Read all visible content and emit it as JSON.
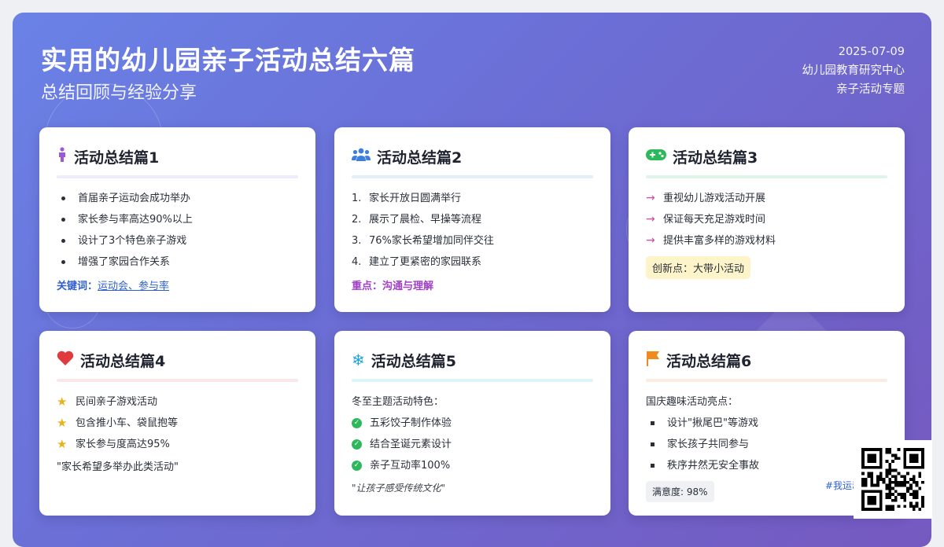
{
  "header": {
    "title": "实用的幼儿园亲子活动总结六篇",
    "subtitle": "总结回顾与经验分享",
    "date": "2025-07-09",
    "org": "幼儿园教育研究中心",
    "topic": "亲子活动专题"
  },
  "colors": {
    "rule1": "#efeafc",
    "rule2": "#e3eefb",
    "rule3": "#def6ea",
    "rule4": "#fbe7ea",
    "rule5": "#dff3fb",
    "rule6": "#fbece2"
  },
  "cards": [
    {
      "icon": "child-icon",
      "title": "活动总结篇1",
      "items": [
        "首届亲子运动会成功举办",
        "家长参与率高达90%以上",
        "设计了3个特色亲子游戏",
        "增强了家园合作关系"
      ],
      "keyword_label": "关键词：",
      "keyword_value": "运动会、参与率"
    },
    {
      "icon": "users-icon",
      "title": "活动总结篇2",
      "nums": [
        "1.",
        "2.",
        "3.",
        "4."
      ],
      "items": [
        "家长开放日圆满举行",
        "展示了晨检、早操等流程",
        "76%家长希望增加同伴交往",
        "建立了更紧密的家园联系"
      ],
      "focus": "重点：沟通与理解"
    },
    {
      "icon": "gamepad-icon",
      "title": "活动总结篇3",
      "items": [
        "重视幼儿游戏活动开展",
        "保证每天充足游戏时间",
        "提供丰富多样的游戏材料"
      ],
      "innovation": "创新点：大带小活动"
    },
    {
      "icon": "heart-icon",
      "title": "活动总结篇4",
      "items": [
        "民间亲子游戏活动",
        "包含推小车、袋鼠抱等",
        "家长参与度高达95%"
      ],
      "quote": "\"家长希望多举办此类活动\""
    },
    {
      "icon": "snowflake-icon",
      "title": "活动总结篇5",
      "intro": "冬至主题活动特色：",
      "items": [
        "五彩饺子制作体验",
        "结合圣诞元素设计",
        "亲子互动率100%"
      ],
      "quote": "\"让孩子感受传统文化\""
    },
    {
      "icon": "flag-icon",
      "title": "活动总结篇6",
      "intro": "国庆趣味活动亮点：",
      "items": [
        "设计\"揪尾巴\"等游戏",
        "家长孩子共同参与",
        "秩序井然无安全事故"
      ],
      "satisfaction": "满意度: 98%",
      "tag": "#我运动"
    }
  ]
}
